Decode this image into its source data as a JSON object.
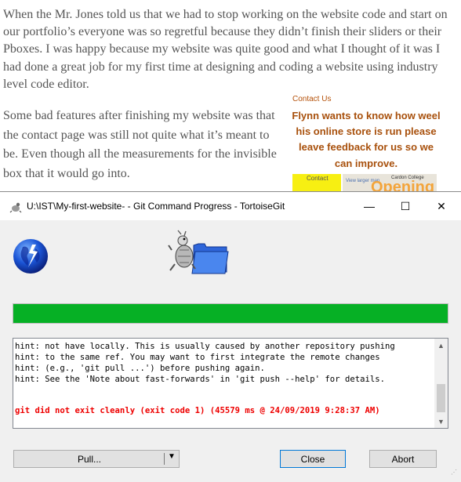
{
  "document": {
    "paragraph1": "When the Mr. Jones told us that we had to stop working on the website code and start on our portfolio’s everyone was so regretful because they didn’t finish their sliders or their Pboxes. I was happy because my website was quite good and what I thought of it was I had done a great job for my first time at designing and coding a website using industry level code editor.",
    "paragraph2": "Some bad features after finishing my website was that the contact page was still not quite what it’s meant to be. Even though all the measurements for the invisible box that it would go into.",
    "contact_heading": "Contact Us",
    "contact_message": "Flynn wants to know how weel his online store is run please leave feedback for us so we can improve.",
    "strip_label": "Contact",
    "strip_map_link": "View larger map",
    "strip_map_place": "Cardon College",
    "strip_opening": "Opening"
  },
  "dialog": {
    "title": "U:\\IST\\My-first-website- - Git Command Progress - TortoiseGit",
    "minimize_glyph": "—",
    "maximize_glyph": "☐",
    "close_glyph": "✕",
    "progress_percent": 100,
    "log_lines": [
      "hint: not have locally. This is usually caused by another repository pushing",
      "hint: to the same ref. You may want to first integrate the remote changes",
      "hint: (e.g., 'git pull ...') before pushing again.",
      "hint: See the 'Note about fast-forwards' in 'git push --help' for details."
    ],
    "error_line": "git did not exit cleanly (exit code 1) (45579 ms @ 24/09/2019 9:28:37 AM)",
    "pull_label": "Pull...",
    "close_label": "Close",
    "abort_label": "Abort",
    "colors": {
      "progress": "#06b025",
      "error": "#ee0000",
      "contact_text": "#a8500c"
    }
  }
}
